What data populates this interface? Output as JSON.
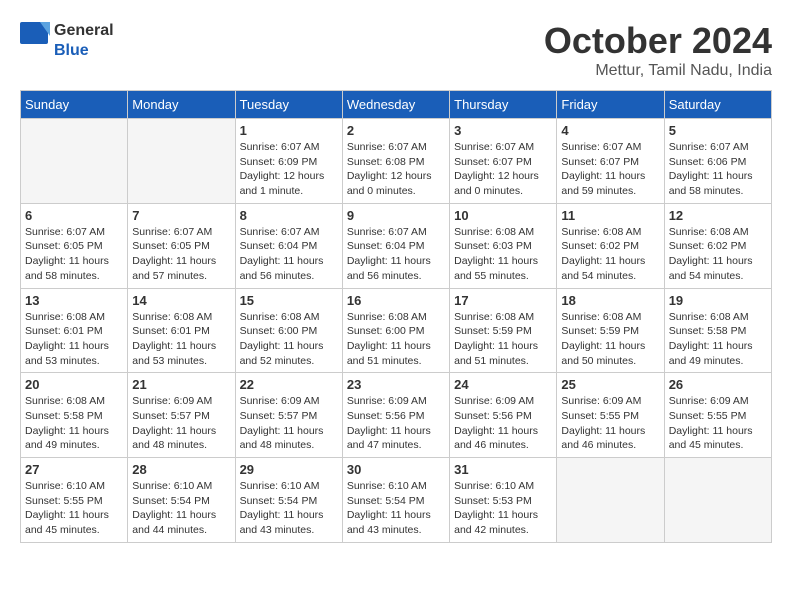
{
  "header": {
    "logo_general": "General",
    "logo_blue": "Blue",
    "month_title": "October 2024",
    "location": "Mettur, Tamil Nadu, India"
  },
  "columns": [
    "Sunday",
    "Monday",
    "Tuesday",
    "Wednesday",
    "Thursday",
    "Friday",
    "Saturday"
  ],
  "weeks": [
    [
      {
        "day": "",
        "sunrise": "",
        "sunset": "",
        "daylight": ""
      },
      {
        "day": "",
        "sunrise": "",
        "sunset": "",
        "daylight": ""
      },
      {
        "day": "1",
        "sunrise": "Sunrise: 6:07 AM",
        "sunset": "Sunset: 6:09 PM",
        "daylight": "Daylight: 12 hours and 1 minute."
      },
      {
        "day": "2",
        "sunrise": "Sunrise: 6:07 AM",
        "sunset": "Sunset: 6:08 PM",
        "daylight": "Daylight: 12 hours and 0 minutes."
      },
      {
        "day": "3",
        "sunrise": "Sunrise: 6:07 AM",
        "sunset": "Sunset: 6:07 PM",
        "daylight": "Daylight: 12 hours and 0 minutes."
      },
      {
        "day": "4",
        "sunrise": "Sunrise: 6:07 AM",
        "sunset": "Sunset: 6:07 PM",
        "daylight": "Daylight: 11 hours and 59 minutes."
      },
      {
        "day": "5",
        "sunrise": "Sunrise: 6:07 AM",
        "sunset": "Sunset: 6:06 PM",
        "daylight": "Daylight: 11 hours and 58 minutes."
      }
    ],
    [
      {
        "day": "6",
        "sunrise": "Sunrise: 6:07 AM",
        "sunset": "Sunset: 6:05 PM",
        "daylight": "Daylight: 11 hours and 58 minutes."
      },
      {
        "day": "7",
        "sunrise": "Sunrise: 6:07 AM",
        "sunset": "Sunset: 6:05 PM",
        "daylight": "Daylight: 11 hours and 57 minutes."
      },
      {
        "day": "8",
        "sunrise": "Sunrise: 6:07 AM",
        "sunset": "Sunset: 6:04 PM",
        "daylight": "Daylight: 11 hours and 56 minutes."
      },
      {
        "day": "9",
        "sunrise": "Sunrise: 6:07 AM",
        "sunset": "Sunset: 6:04 PM",
        "daylight": "Daylight: 11 hours and 56 minutes."
      },
      {
        "day": "10",
        "sunrise": "Sunrise: 6:08 AM",
        "sunset": "Sunset: 6:03 PM",
        "daylight": "Daylight: 11 hours and 55 minutes."
      },
      {
        "day": "11",
        "sunrise": "Sunrise: 6:08 AM",
        "sunset": "Sunset: 6:02 PM",
        "daylight": "Daylight: 11 hours and 54 minutes."
      },
      {
        "day": "12",
        "sunrise": "Sunrise: 6:08 AM",
        "sunset": "Sunset: 6:02 PM",
        "daylight": "Daylight: 11 hours and 54 minutes."
      }
    ],
    [
      {
        "day": "13",
        "sunrise": "Sunrise: 6:08 AM",
        "sunset": "Sunset: 6:01 PM",
        "daylight": "Daylight: 11 hours and 53 minutes."
      },
      {
        "day": "14",
        "sunrise": "Sunrise: 6:08 AM",
        "sunset": "Sunset: 6:01 PM",
        "daylight": "Daylight: 11 hours and 53 minutes."
      },
      {
        "day": "15",
        "sunrise": "Sunrise: 6:08 AM",
        "sunset": "Sunset: 6:00 PM",
        "daylight": "Daylight: 11 hours and 52 minutes."
      },
      {
        "day": "16",
        "sunrise": "Sunrise: 6:08 AM",
        "sunset": "Sunset: 6:00 PM",
        "daylight": "Daylight: 11 hours and 51 minutes."
      },
      {
        "day": "17",
        "sunrise": "Sunrise: 6:08 AM",
        "sunset": "Sunset: 5:59 PM",
        "daylight": "Daylight: 11 hours and 51 minutes."
      },
      {
        "day": "18",
        "sunrise": "Sunrise: 6:08 AM",
        "sunset": "Sunset: 5:59 PM",
        "daylight": "Daylight: 11 hours and 50 minutes."
      },
      {
        "day": "19",
        "sunrise": "Sunrise: 6:08 AM",
        "sunset": "Sunset: 5:58 PM",
        "daylight": "Daylight: 11 hours and 49 minutes."
      }
    ],
    [
      {
        "day": "20",
        "sunrise": "Sunrise: 6:08 AM",
        "sunset": "Sunset: 5:58 PM",
        "daylight": "Daylight: 11 hours and 49 minutes."
      },
      {
        "day": "21",
        "sunrise": "Sunrise: 6:09 AM",
        "sunset": "Sunset: 5:57 PM",
        "daylight": "Daylight: 11 hours and 48 minutes."
      },
      {
        "day": "22",
        "sunrise": "Sunrise: 6:09 AM",
        "sunset": "Sunset: 5:57 PM",
        "daylight": "Daylight: 11 hours and 48 minutes."
      },
      {
        "day": "23",
        "sunrise": "Sunrise: 6:09 AM",
        "sunset": "Sunset: 5:56 PM",
        "daylight": "Daylight: 11 hours and 47 minutes."
      },
      {
        "day": "24",
        "sunrise": "Sunrise: 6:09 AM",
        "sunset": "Sunset: 5:56 PM",
        "daylight": "Daylight: 11 hours and 46 minutes."
      },
      {
        "day": "25",
        "sunrise": "Sunrise: 6:09 AM",
        "sunset": "Sunset: 5:55 PM",
        "daylight": "Daylight: 11 hours and 46 minutes."
      },
      {
        "day": "26",
        "sunrise": "Sunrise: 6:09 AM",
        "sunset": "Sunset: 5:55 PM",
        "daylight": "Daylight: 11 hours and 45 minutes."
      }
    ],
    [
      {
        "day": "27",
        "sunrise": "Sunrise: 6:10 AM",
        "sunset": "Sunset: 5:55 PM",
        "daylight": "Daylight: 11 hours and 45 minutes."
      },
      {
        "day": "28",
        "sunrise": "Sunrise: 6:10 AM",
        "sunset": "Sunset: 5:54 PM",
        "daylight": "Daylight: 11 hours and 44 minutes."
      },
      {
        "day": "29",
        "sunrise": "Sunrise: 6:10 AM",
        "sunset": "Sunset: 5:54 PM",
        "daylight": "Daylight: 11 hours and 43 minutes."
      },
      {
        "day": "30",
        "sunrise": "Sunrise: 6:10 AM",
        "sunset": "Sunset: 5:54 PM",
        "daylight": "Daylight: 11 hours and 43 minutes."
      },
      {
        "day": "31",
        "sunrise": "Sunrise: 6:10 AM",
        "sunset": "Sunset: 5:53 PM",
        "daylight": "Daylight: 11 hours and 42 minutes."
      },
      {
        "day": "",
        "sunrise": "",
        "sunset": "",
        "daylight": ""
      },
      {
        "day": "",
        "sunrise": "",
        "sunset": "",
        "daylight": ""
      }
    ]
  ]
}
